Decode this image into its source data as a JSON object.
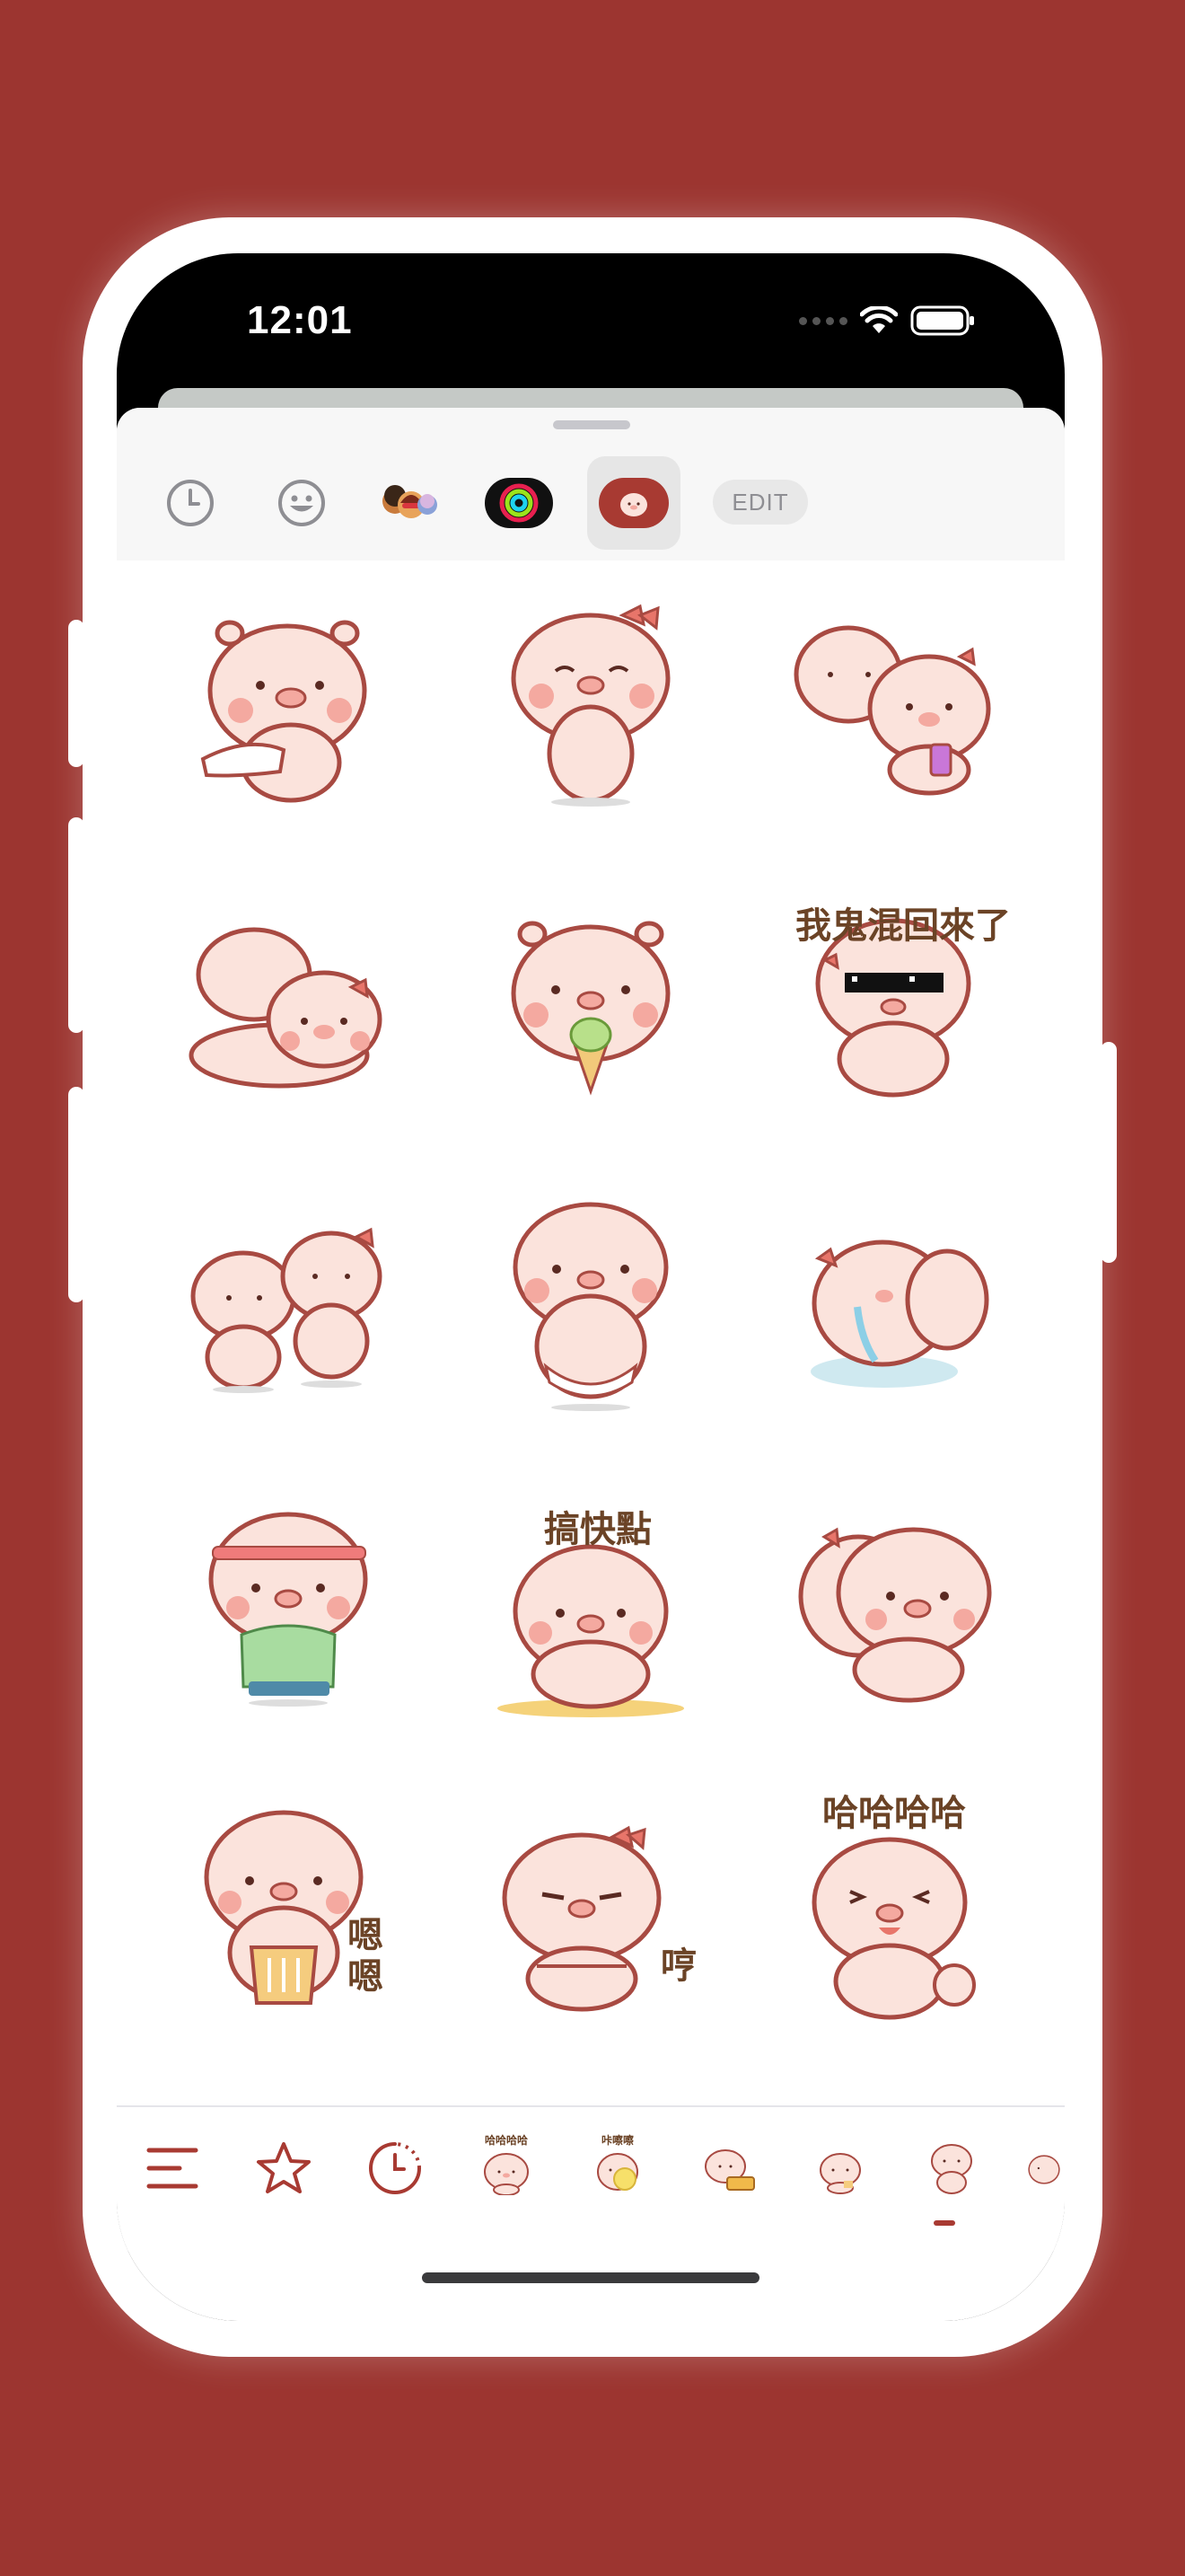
{
  "status_bar": {
    "time": "12:01"
  },
  "top_bar": {
    "icons": [
      "recent-clock-icon",
      "emoji-smiley-icon",
      "memoji-icon",
      "activity-rings-icon",
      "sticker-pack-icon"
    ],
    "edit_label": "EDIT"
  },
  "stickers": [
    {
      "id": "pig-hug-hand"
    },
    {
      "id": "pig-bow-shy"
    },
    {
      "id": "pigs-couple-phone"
    },
    {
      "id": "pigs-lying"
    },
    {
      "id": "pig-ice-cream"
    },
    {
      "id": "pig-sunglasses",
      "caption": "我鬼混回來了"
    },
    {
      "id": "pigs-two-standing"
    },
    {
      "id": "pig-diaper"
    },
    {
      "id": "pig-crying-floor"
    },
    {
      "id": "pig-headband-sport"
    },
    {
      "id": "pig-hurry",
      "caption": "搞快點"
    },
    {
      "id": "pigs-hugging"
    },
    {
      "id": "pig-nod",
      "caption_lines": [
        "嗯",
        "嗯"
      ]
    },
    {
      "id": "pig-hmph",
      "caption": "哼"
    },
    {
      "id": "pig-laugh",
      "caption": "哈哈哈哈"
    }
  ],
  "bottom_bar": {
    "icons": [
      "menu-lines-icon",
      "favorites-star-icon",
      "recents-clock-icon"
    ],
    "packs": [
      {
        "caption": "哈哈哈哈"
      },
      {
        "caption": "咔嚓嚓"
      },
      {},
      {},
      {},
      {}
    ]
  },
  "colors": {
    "background": "#9c3530",
    "accent": "#a83a32",
    "pig_fill": "#fbe3dc",
    "pig_outline": "#a84a42",
    "cheek": "#f4a9a0"
  }
}
